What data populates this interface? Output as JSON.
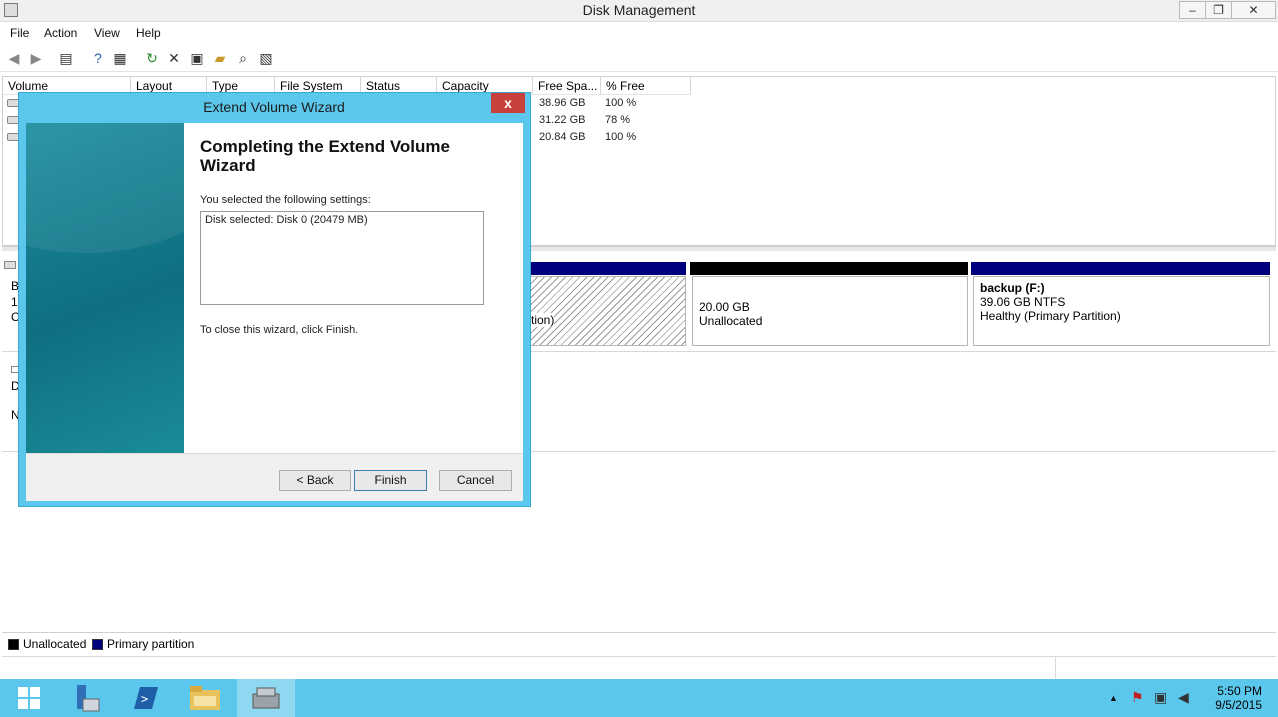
{
  "window": {
    "title": "Disk Management",
    "minimize": "–",
    "restore": "❐",
    "close": "✕"
  },
  "menu": [
    "File",
    "Action",
    "View",
    "Help"
  ],
  "toolbar_icons": [
    "back-arrow-icon",
    "forward-arrow-icon",
    "console-tree-icon",
    "help-icon",
    "properties-icon",
    "refresh-icon",
    "delete-icon",
    "disk-properties-icon",
    "open-folder-icon",
    "explore-icon",
    "rescan-icon"
  ],
  "volume_list": {
    "columns": [
      "Volume",
      "Layout",
      "Type",
      "File System",
      "Status",
      "Capacity",
      "Free Spa...",
      "% Free"
    ],
    "rows": [
      {
        "free": "38.96 GB",
        "pct": "100 %"
      },
      {
        "free": "31.22 GB",
        "pct": "78 %"
      },
      {
        "free": "20.84 GB",
        "pct": "100 %"
      }
    ]
  },
  "disk_map": {
    "disk0_side": [
      "B",
      "1",
      "O"
    ],
    "disk1_side": [
      "D",
      "N"
    ],
    "hidden_partition_text": "tion)",
    "unallocated": {
      "size": "20.00 GB",
      "label": "Unallocated"
    },
    "backup": {
      "name": "backup  (F:)",
      "size": "39.06 GB NTFS",
      "status": "Healthy (Primary Partition)"
    }
  },
  "legend": {
    "unallocated": "Unallocated",
    "primary": "Primary partition"
  },
  "taskbar": {
    "time": "5:50 PM",
    "date": "9/5/2015"
  },
  "dialog": {
    "title": "Extend Volume Wizard",
    "close": "x",
    "heading": "Completing the Extend Volume Wizard",
    "selected_label": "You selected the following settings:",
    "settings_text": "Disk selected: Disk 0 (20479 MB)",
    "close_instruction": "To close this wizard, click Finish.",
    "buttons": {
      "back": "< Back",
      "finish": "Finish",
      "cancel": "Cancel"
    }
  },
  "colors": {
    "primary_partition": "#00007f",
    "unallocated": "#000000",
    "taskbar": "#5bc7ec",
    "dialog_close": "#c7403a"
  }
}
